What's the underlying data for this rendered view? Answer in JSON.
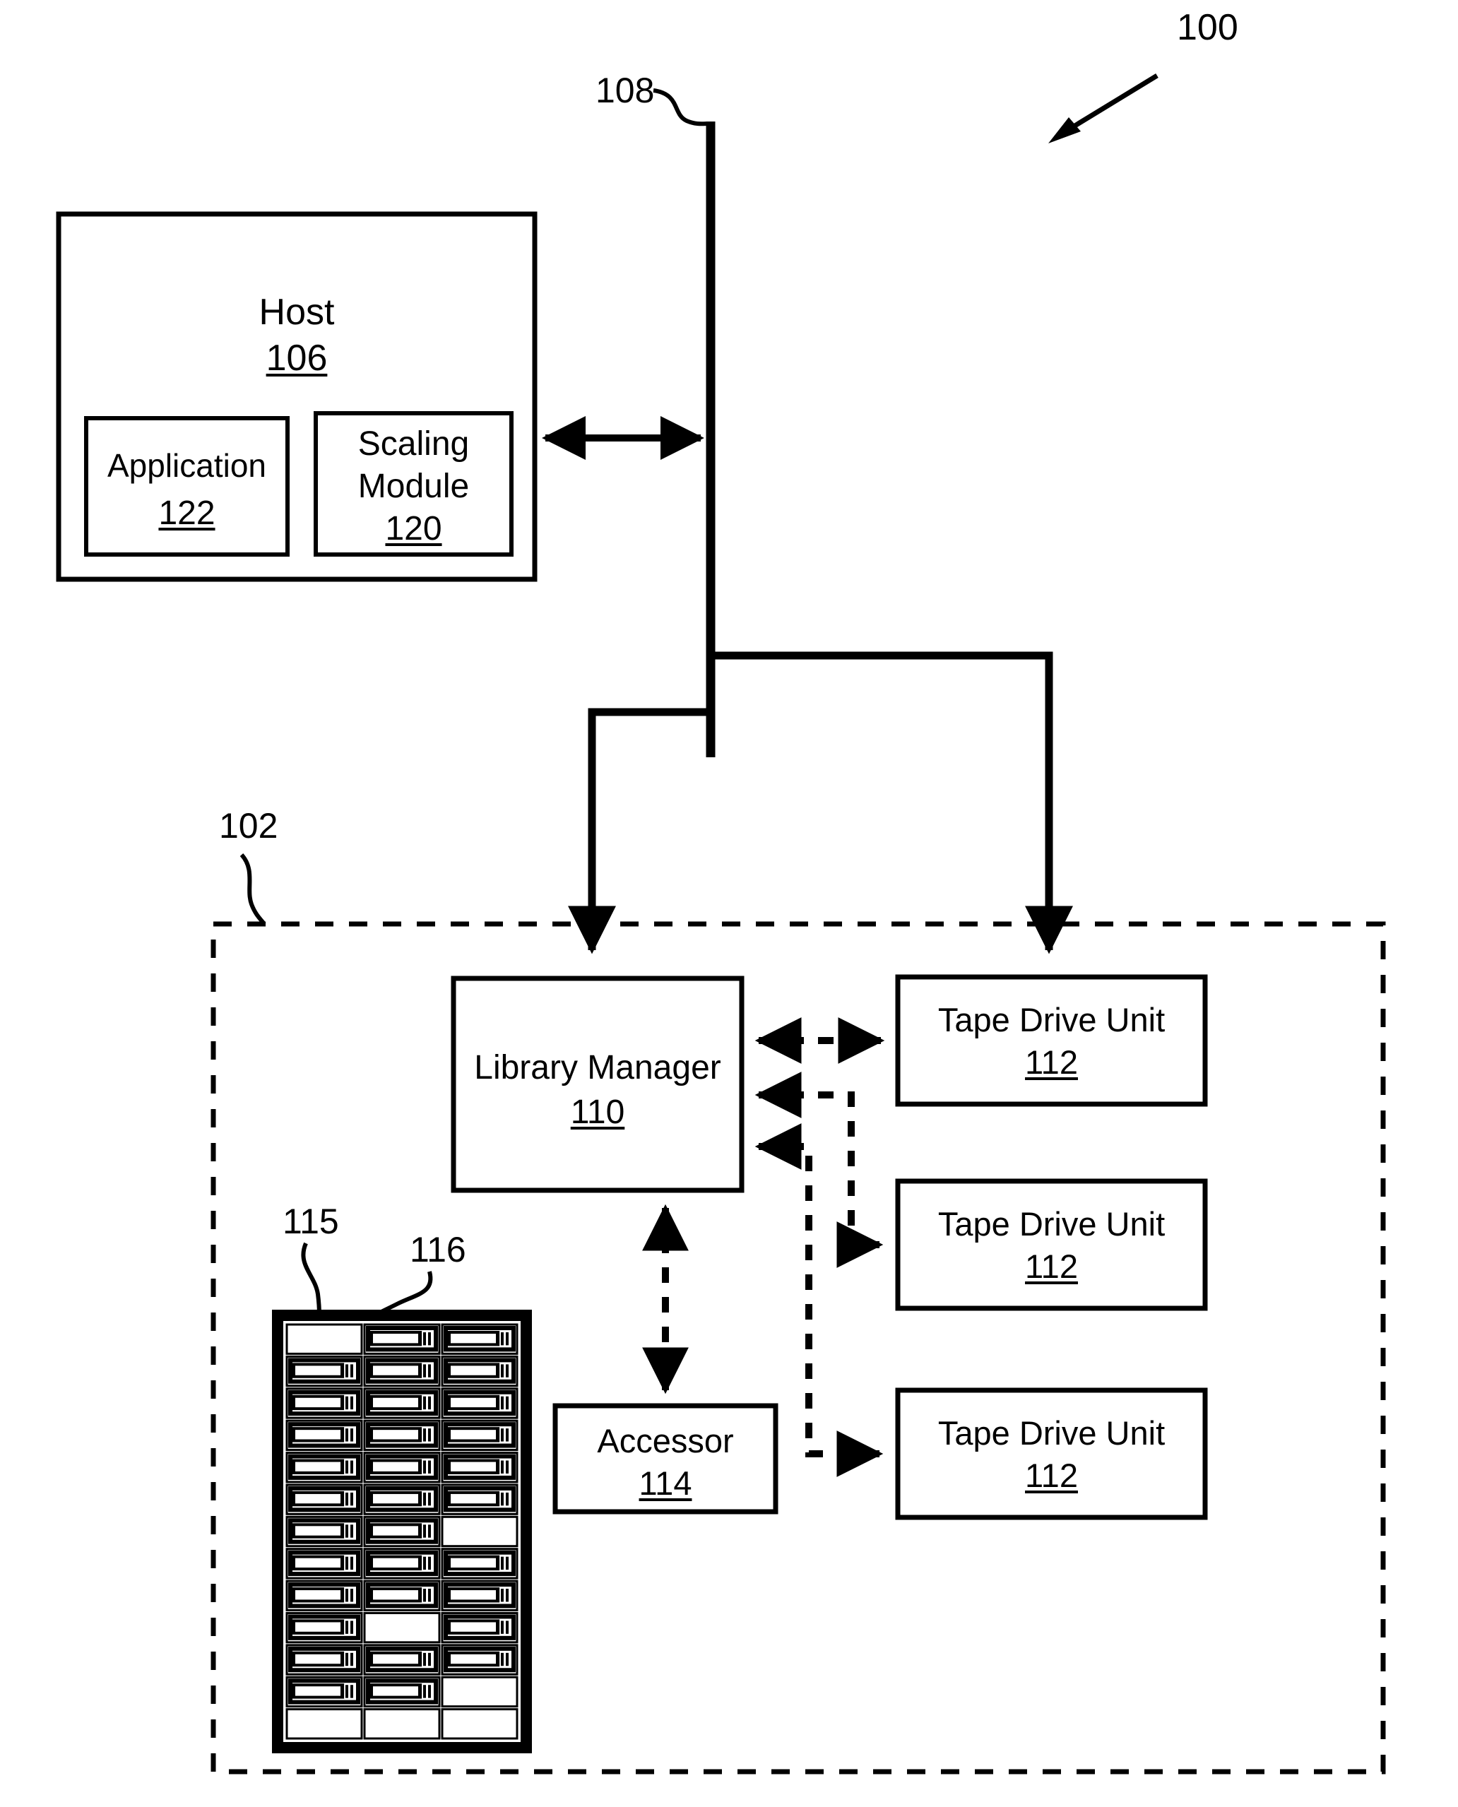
{
  "figure": {
    "type": "patent-block-diagram",
    "system_ref": "100",
    "background": "#ffffff",
    "ink": "#000000"
  },
  "refs": {
    "system": "100",
    "bus": "108",
    "library": "102",
    "magazine": "115",
    "cartridge": "116"
  },
  "host": {
    "title": "Host",
    "ref": "106",
    "children": [
      {
        "title": "Application",
        "ref": "122"
      },
      {
        "title": "Scaling\nModule",
        "ref": "120",
        "line1": "Scaling",
        "line2": "Module"
      }
    ]
  },
  "library": {
    "ref": "102",
    "manager": {
      "title": "Library Manager",
      "ref": "110"
    },
    "accessor": {
      "title": "Accessor",
      "ref": "114"
    },
    "tape_drives": [
      {
        "title": "Tape Drive Unit",
        "ref": "112"
      },
      {
        "title": "Tape Drive Unit",
        "ref": "112"
      },
      {
        "title": "Tape Drive Unit",
        "ref": "112"
      }
    ],
    "magazine": {
      "ref": "115",
      "cartridge_ref": "116",
      "rows": 13,
      "columns": 3,
      "occupancy": [
        [
          0,
          1,
          1
        ],
        [
          1,
          1,
          1
        ],
        [
          1,
          1,
          1
        ],
        [
          1,
          1,
          1
        ],
        [
          1,
          1,
          1
        ],
        [
          1,
          1,
          1
        ],
        [
          1,
          1,
          0
        ],
        [
          1,
          1,
          1
        ],
        [
          1,
          1,
          1
        ],
        [
          1,
          0,
          1
        ],
        [
          1,
          1,
          1
        ],
        [
          1,
          1,
          0
        ],
        [
          0,
          0,
          0
        ]
      ]
    }
  },
  "connections": [
    {
      "from": "host",
      "to": "bus",
      "style": "solid",
      "arrows": "both"
    },
    {
      "from": "bus",
      "to": "library-manager",
      "style": "solid",
      "arrows": "end"
    },
    {
      "from": "bus",
      "to": "tape-drive-1",
      "style": "solid",
      "arrows": "end"
    },
    {
      "from": "library-manager",
      "to": "tape-drive-1",
      "style": "dashed",
      "arrows": "both"
    },
    {
      "from": "library-manager",
      "to": "tape-drive-2",
      "style": "dashed",
      "arrows": "both"
    },
    {
      "from": "library-manager",
      "to": "tape-drive-3",
      "style": "dashed",
      "arrows": "both"
    },
    {
      "from": "library-manager",
      "to": "accessor",
      "style": "dashed",
      "arrows": "both"
    }
  ]
}
